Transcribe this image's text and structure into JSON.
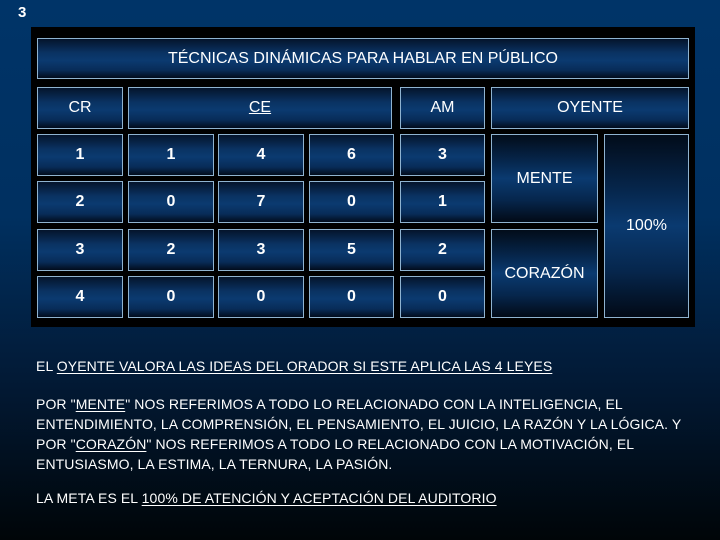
{
  "slide_number": "3",
  "table": {
    "title": "TÉCNICAS DINÁMICAS PARA HABLAR EN PÚBLICO",
    "headers": {
      "cr": "CR",
      "ce": "CE",
      "am": "AM",
      "oyente": "OYENTE"
    },
    "rows": [
      [
        "1",
        "1",
        "4",
        "6",
        "3"
      ],
      [
        "2",
        "0",
        "7",
        "0",
        "1"
      ],
      [
        "3",
        "2",
        "3",
        "5",
        "2"
      ],
      [
        "4",
        "0",
        "0",
        "0",
        "0"
      ]
    ],
    "oyente_cells": {
      "mente": "MENTE",
      "corazon": "CORAZÓN",
      "percent": "100%"
    }
  },
  "paragraphs": {
    "p1": {
      "prefix": "EL ",
      "underlined": "OYENTE VALORA LAS IDEAS DEL ORADOR SI ESTE APLICA LAS 4 LEYES"
    },
    "p2": {
      "part1": "POR \"",
      "mente": "MENTE",
      "part2": "\" NOS REFERIMOS A TODO LO RELACIONADO CON LA INTELIGENCIA, EL ENTENDIMIENTO, LA COMPRENSIÓN, EL PENSAMIENTO, EL JUICIO, LA RAZÓN Y LA LÓGICA. Y POR \"",
      "corazon": "CORAZÓN",
      "part3": "\" NOS REFERIMOS A TODO LO RELACIONADO CON LA MOTIVACIÓN, EL ENTUSIASMO, LA ESTIMA, LA TERNURA, LA PASIÓN."
    },
    "p3": {
      "prefix": "LA META ES EL ",
      "underlined": "100% DE ATENCIÓN Y ACEPTACIÓN DEL AUDITORIO"
    }
  }
}
